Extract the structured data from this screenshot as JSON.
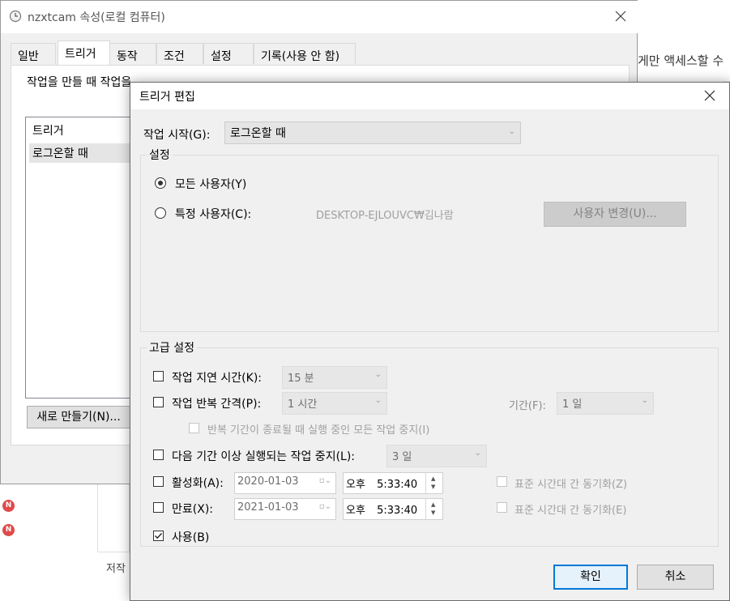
{
  "background_window": {
    "title": "nzxtcam 속성(로컬 컴퓨터)",
    "tabs": [
      "일반",
      "트리거",
      "동작",
      "조건",
      "설정",
      "기록(사용 안 함)"
    ],
    "active_tab": "트리거",
    "description": "작업을 만들 때 작업을 트리거할 조건을 지정할 수 있습니다.",
    "list_header": "트리거",
    "list_items": [
      "로그온할 때"
    ],
    "new_button": "새로 만들기(N)..."
  },
  "far_background": {
    "right_text": "게만 액세스할 수",
    "bottom_text": "저작"
  },
  "dialog": {
    "title": "트리거 편집",
    "begin_task_label": "작업 시작(G):",
    "begin_task_value": "로그온할 때",
    "settings_group": "설정",
    "any_user_label": "모든 사용자(Y)",
    "specific_user_label": "특정 사용자(C):",
    "specific_user_value": "DESKTOP-EJLOUVC₩김나람",
    "change_user_button": "사용자 변경(U)...",
    "advanced_group": "고급 설정",
    "delay_label": "작업 지연 시간(K):",
    "delay_value": "15 분",
    "repeat_label": "작업 반복 간격(P):",
    "repeat_value": "1 시간",
    "duration_label": "기간(F):",
    "duration_value": "1 일",
    "stop_running_label": "반복 기간이 종료될 때 실행 중인 모든 작업 중지(I)",
    "stop_longer_label": "다음 기간 이상 실행되는 작업 중지(L):",
    "stop_longer_value": "3 일",
    "activate_label": "활성화(A):",
    "activate_date": "2020-01-03",
    "activate_ampm": "오후",
    "activate_time": "5:33:40",
    "sync_activate_label": "표준 시간대 간 동기화(Z)",
    "expire_label": "만료(X):",
    "expire_date": "2021-01-03",
    "expire_ampm": "오후",
    "expire_time": "5:33:40",
    "sync_expire_label": "표준 시간대 간 동기화(E)",
    "enabled_label": "사용(B)",
    "ok_button": "확인",
    "cancel_button": "취소"
  },
  "icons": {
    "clock": "clock-icon",
    "close": "close-icon",
    "notify": "N"
  }
}
